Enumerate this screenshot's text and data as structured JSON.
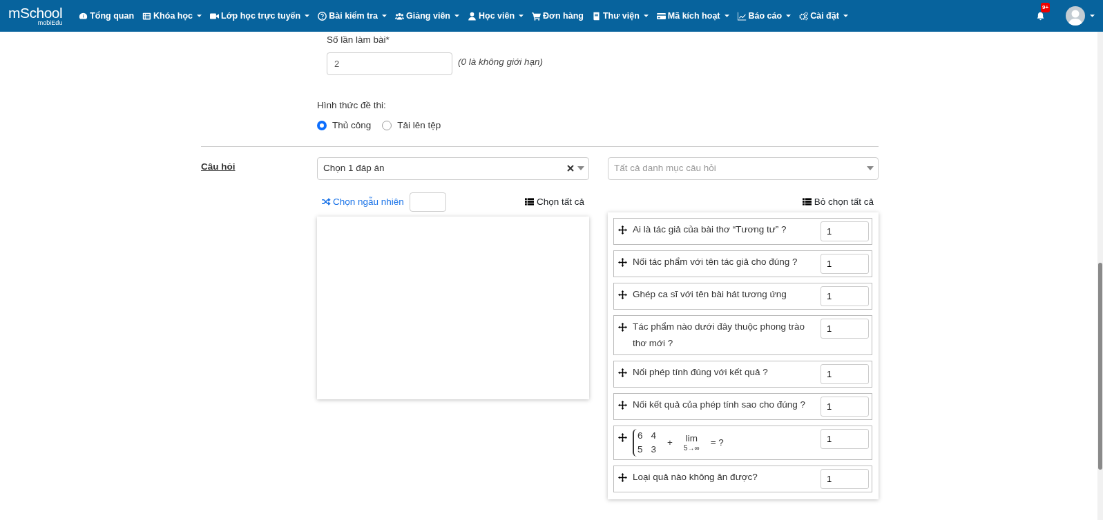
{
  "navbar": {
    "logo": {
      "main": "mSchool",
      "sub": "mobiEdu"
    },
    "items": [
      {
        "label": "Tổng quan",
        "dropdown": false
      },
      {
        "label": "Khóa học",
        "dropdown": true
      },
      {
        "label": "Lớp học trực tuyến",
        "dropdown": true
      },
      {
        "label": "Bài kiểm tra",
        "dropdown": true
      },
      {
        "label": "Giảng viên",
        "dropdown": true
      },
      {
        "label": "Học viên",
        "dropdown": true
      },
      {
        "label": "Đơn hàng",
        "dropdown": false
      },
      {
        "label": "Thư viện",
        "dropdown": true
      },
      {
        "label": "Mã kích hoạt",
        "dropdown": true
      },
      {
        "label": "Báo cáo",
        "dropdown": true
      },
      {
        "label": "Cài đặt",
        "dropdown": true
      }
    ],
    "notifications_badge": "9+"
  },
  "attempts": {
    "label": "Số lần làm bài*",
    "value": "2",
    "hint": "(0 là không giới hạn)"
  },
  "exam_format": {
    "label": "Hình thức đề thi:",
    "options": [
      {
        "label": "Thủ công",
        "selected": true
      },
      {
        "label": "Tải lên tệp",
        "selected": false
      }
    ]
  },
  "questions": {
    "label": "Câu hỏi",
    "type_select": {
      "value": "Chọn 1 đáp án"
    },
    "category_select": {
      "placeholder": "Tất cả danh mục câu hỏi"
    },
    "random_link": "Chọn ngẫu nhiên",
    "select_all": "Chọn tất cả",
    "deselect_all": "Bỏ chọn tất cả",
    "selected": [
      {
        "kind": "text",
        "text": "Ai là tác giả của bài thơ “Tương tư” ?",
        "score": "1"
      },
      {
        "kind": "text",
        "text": "Nối tác phẩm với tên tác giả cho đúng ?",
        "score": "1"
      },
      {
        "kind": "text",
        "text": "Ghép ca sĩ với tên bài hát tương ứng",
        "score": "1"
      },
      {
        "kind": "text",
        "text": "Tác phẩm nào dưới đây thuộc phong trào thơ mới ?",
        "score": "1"
      },
      {
        "kind": "text",
        "text": "Nối phép tính đúng với kết quả ?",
        "score": "1"
      },
      {
        "kind": "text",
        "text": "Nối kết quả của phép tính sao cho đúng ?",
        "score": "1"
      },
      {
        "kind": "math",
        "rows": [
          [
            "6",
            "4"
          ],
          [
            "5",
            "3"
          ]
        ],
        "operator": "+",
        "limit": "lim",
        "limit_sub": "5→∞",
        "tail": "= ?",
        "score": "1"
      },
      {
        "kind": "text",
        "text": "Loại quả nào không ăn được?",
        "score": "1"
      }
    ]
  }
}
